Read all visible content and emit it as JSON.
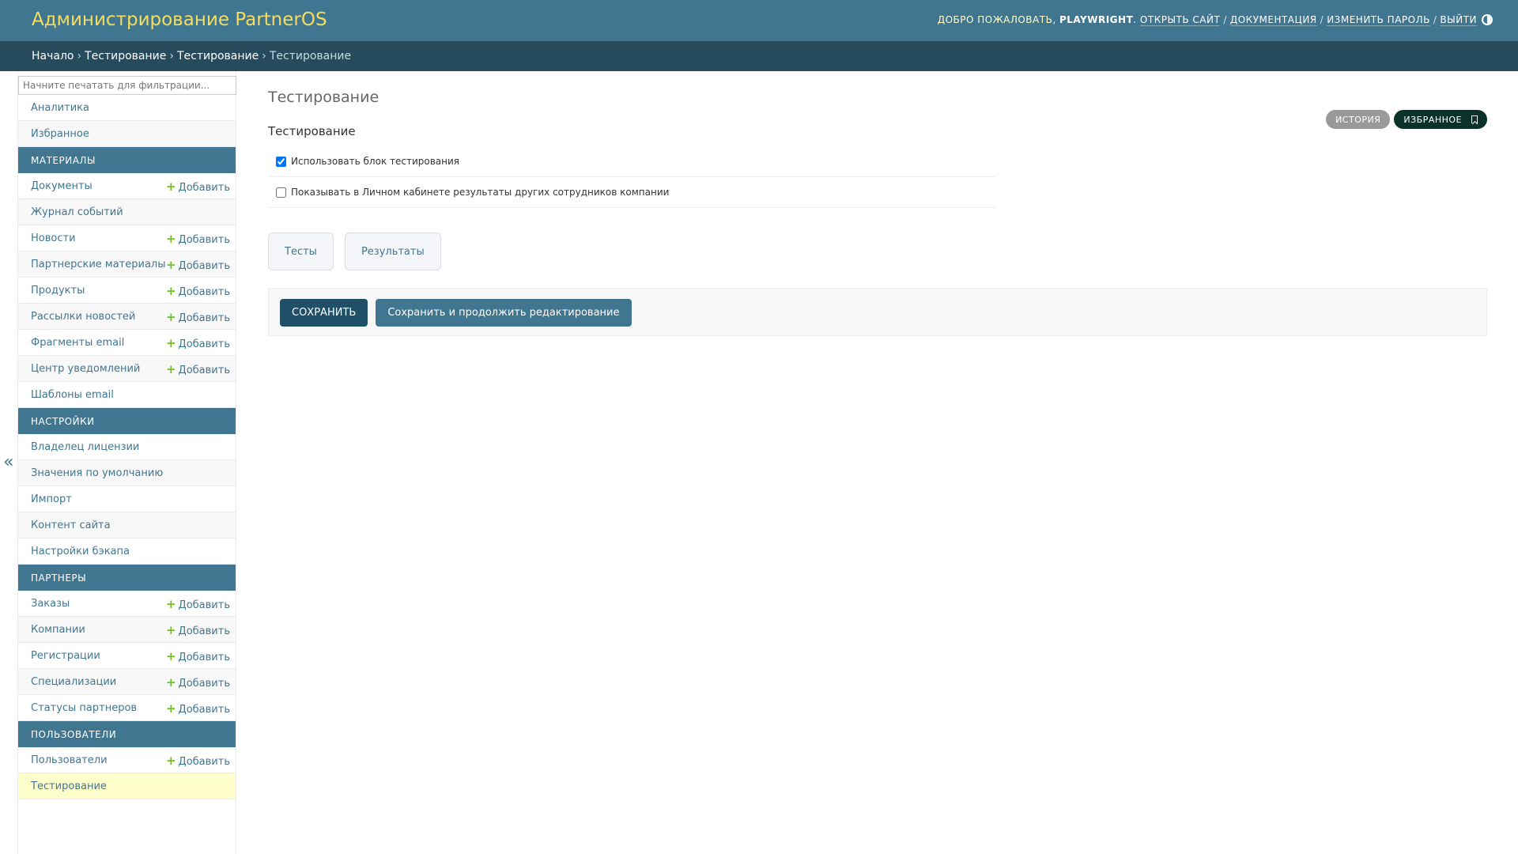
{
  "header": {
    "site_title": "Администрирование PartnerOS",
    "welcome": "Добро пожаловать,",
    "username": "playwright",
    "links": [
      "Открыть сайт",
      "Документация",
      "Изменить пароль",
      "Выйти"
    ],
    "theme_icon": "contrast-icon"
  },
  "breadcrumbs": {
    "items": [
      "Начало",
      "Тестирование",
      "Тестирование"
    ],
    "current": "Тестирование"
  },
  "sidebar": {
    "filter_placeholder": "Начните печатать для фильтрации...",
    "top_items": [
      "Аналитика",
      "Избранное"
    ],
    "add_label": "Добавить",
    "sections": [
      {
        "caption": "Материалы",
        "items": [
          {
            "label": "Документы",
            "add": true
          },
          {
            "label": "Журнал событий",
            "add": false
          },
          {
            "label": "Новости",
            "add": true
          },
          {
            "label": "Партнерские материалы",
            "add": true
          },
          {
            "label": "Продукты",
            "add": true
          },
          {
            "label": "Рассылки новостей",
            "add": true
          },
          {
            "label": "Фрагменты email",
            "add": true
          },
          {
            "label": "Центр уведомлений",
            "add": true
          },
          {
            "label": "Шаблоны email",
            "add": false
          }
        ]
      },
      {
        "caption": "Настройки",
        "items": [
          {
            "label": "Владелец лицензии",
            "add": false
          },
          {
            "label": "Значения по умолчанию",
            "add": false
          },
          {
            "label": "Импорт",
            "add": false
          },
          {
            "label": "Контент сайта",
            "add": false
          },
          {
            "label": "Настройки бэкапа",
            "add": false
          }
        ]
      },
      {
        "caption": "Партнеры",
        "items": [
          {
            "label": "Заказы",
            "add": true
          },
          {
            "label": "Компании",
            "add": true
          },
          {
            "label": "Регистрации",
            "add": true
          },
          {
            "label": "Специализации",
            "add": true
          },
          {
            "label": "Статусы партнеров",
            "add": true
          }
        ]
      },
      {
        "caption": "Пользователи",
        "items": [
          {
            "label": "Пользователи",
            "add": true
          },
          {
            "label": "Тестирование",
            "add": false,
            "selected": true
          }
        ]
      }
    ],
    "collapse_glyph": "«"
  },
  "content": {
    "title": "Тестирование",
    "history_button": "История",
    "favorite_button": "Избранное",
    "fieldset_title": "Тестирование",
    "fields": [
      {
        "label": "Использовать блок тестирования",
        "checked": true
      },
      {
        "label": "Показывать в Личном кабинете результаты других сотрудников компании",
        "checked": false
      }
    ],
    "tabs": [
      "Тесты",
      "Результаты"
    ],
    "save_button": "Сохранить",
    "save_continue_button": "Сохранить и продолжить редактирование"
  },
  "colors": {
    "header_bg": "#417690",
    "breadcrumb_bg": "#264b5d",
    "title_yellow": "#f5dd5d",
    "link": "#417690",
    "add_plus": "#70bf2b",
    "selected_row": "#ffffcc",
    "favorite_bg": "#0b3228"
  }
}
